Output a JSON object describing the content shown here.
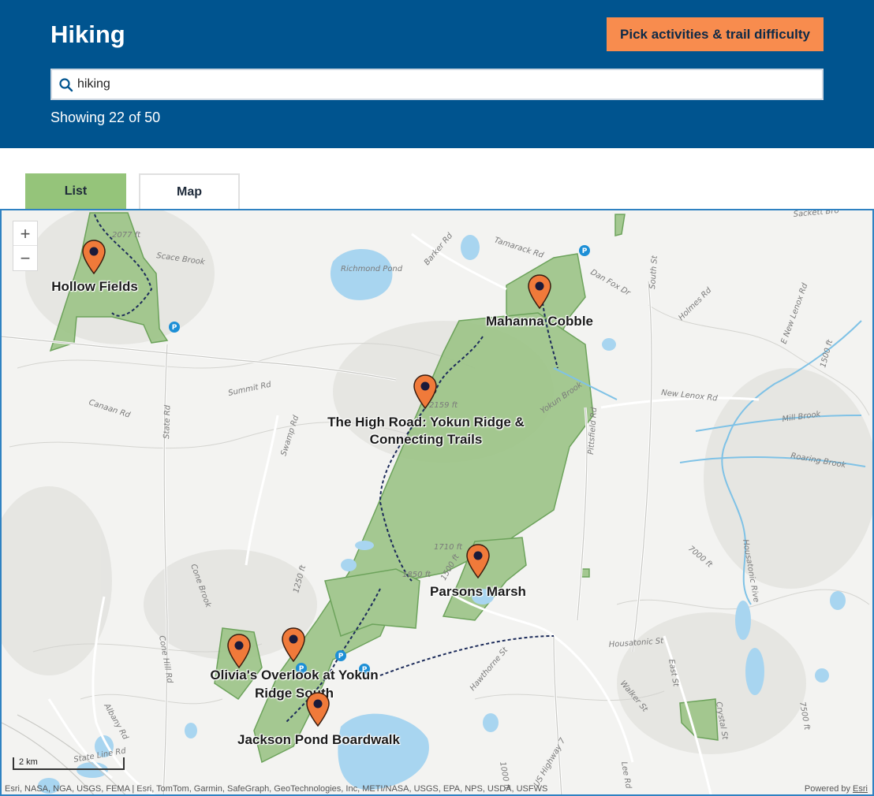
{
  "header": {
    "title": "Hiking",
    "pick_button": "Pick activities & trail difficulty",
    "search_value": "hiking",
    "showing": "Showing 22 of 50"
  },
  "tabs": {
    "list": "List",
    "map": "Map"
  },
  "map": {
    "markers": [
      {
        "name": "Hollow Fields"
      },
      {
        "name": "Mahanna Cobble"
      },
      {
        "name": "The High Road: Yokun Ridge & Connecting Trails"
      },
      {
        "name": "Parsons Marsh"
      },
      {
        "name": "Olivia's Overlook at Yokun Ridge South"
      },
      {
        "name": "Jackson Pond Boardwalk"
      }
    ],
    "labels": {
      "m0": "Hollow Fields",
      "m1": "Mahanna Cobble",
      "m2a": "The High Road: Yokun Ridge &",
      "m2b": "Connecting Trails",
      "m3": "Parsons Marsh",
      "m4a": "Olivia's Overlook at Yokun",
      "m4b": "Ridge South",
      "m5": "Jackson Pond Boardwalk"
    },
    "places": {
      "richmond_pond": "Richmond Pond",
      "scace_brook": "Scace Brook",
      "tamarack_rd": "Tamarack Rd",
      "barker_rd": "Barker Rd",
      "summit_rd": "Summit Rd",
      "canaan_rd": "Canaan Rd",
      "state_rd": "State Rd",
      "swamp_rd": "Swamp Rd",
      "yokun_brook": "Yokun Brook",
      "pittsfield_rd": "Pittsfield Rd",
      "new_lenox_rd": "New Lenox Rd",
      "mill_brook": "Mill Brook",
      "roaring_brook": "Roaring Brook",
      "south_st": "South St",
      "dan_fox_dr": "Dan Fox Dr",
      "holmes_rd": "Holmes Rd",
      "e_new_lenox_rd": "E New Lenox Rd",
      "sackett_brook": "Sackett Bro",
      "cone_brook": "Cone Brook",
      "cone_hill_rd": "Cone Hill Rd",
      "albany_rd": "Albany Rd",
      "state_line_rd": "State Line Rd",
      "housatonic_st": "Housatonic St",
      "housatonic_river": "Housatonic Rive",
      "east_st": "East St",
      "walker_st": "Walker St",
      "crystal_st": "Crystal St",
      "lee_rd": "Lee Rd",
      "hawthorne_st": "Hawthorne St",
      "us_highway_7": "US Highway 7",
      "e1": "2077 ft",
      "e2": "2159 ft",
      "e3": "1710 ft",
      "e4": "1850 ft",
      "e5": "1250 ft",
      "e6": "1500 ft",
      "e7": "1000 ft",
      "e8": "1500 ft",
      "e9": "1250 ft",
      "e10": "7000 ft",
      "e11": "7500 ft"
    },
    "scale": "2 km",
    "attribution": "Esri, NASA, NGA, USGS, FEMA | Esri, TomTom, Garmin, SafeGraph, GeoTechnologies, Inc, METI/NASA, USGS, EPA, NPS, USDA, USFWS",
    "powered_by": "Powered by",
    "esri": "Esri",
    "colors": {
      "header": "#00548f",
      "accent": "#f88c4e",
      "tab_active": "#95c47a",
      "park": "#9cc487",
      "water": "#a8d5f0",
      "marker": "#f07a3a"
    }
  }
}
